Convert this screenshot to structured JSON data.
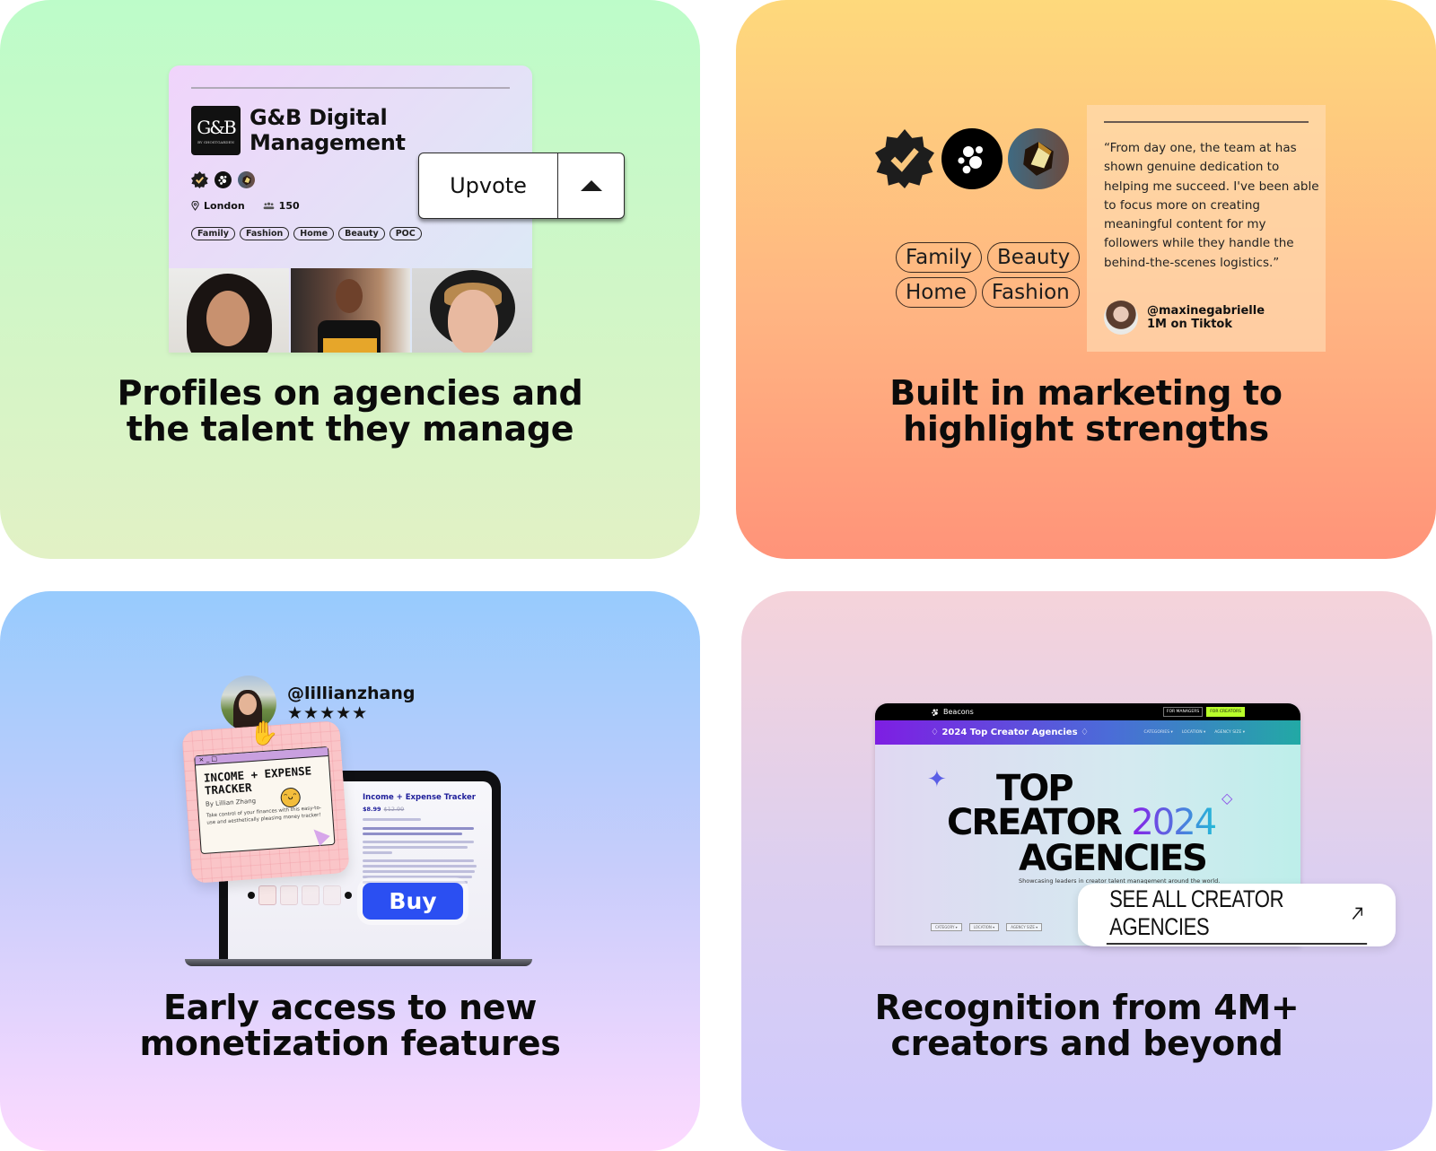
{
  "panels": {
    "profiles": {
      "caption": [
        "Profiles on agencies and",
        "the talent they manage"
      ],
      "agency": {
        "logo_text": "G&B",
        "logo_subtext": "BY GHOSTGARDEN",
        "name_line1": "G&B Digital",
        "name_line2": "Management",
        "badges": [
          "verified-badge-icon",
          "beacons-badge-icon",
          "gem-badge-icon"
        ],
        "location": "London",
        "talent_count": "150",
        "tags": [
          "Family",
          "Fashion",
          "Home",
          "Beauty",
          "POC"
        ]
      },
      "upvote_button": {
        "label": "Upvote",
        "arrow": "up-triangle-icon"
      }
    },
    "marketing": {
      "caption": [
        "Built in marketing to",
        "highlight strengths"
      ],
      "badges": [
        "verified-badge-icon",
        "beacons-badge-icon",
        "gem-badge-icon"
      ],
      "tags_row1": [
        "Family",
        "Beauty"
      ],
      "tags_row2": [
        "Home",
        "Fashion"
      ],
      "testimonial": {
        "quote": "“From day one, the team at has shown genuine dedication to helping me succeed. I've been able to focus more on creating meaningful content for my followers while they handle the behind-the-scenes logistics.”",
        "handle": "@maxinegabrielle",
        "followers": "1M on Tiktok"
      }
    },
    "monetization": {
      "caption": [
        "Early access to new",
        "monetization features"
      ],
      "creator": {
        "handle": "@lillianzhang",
        "rating": 5,
        "stars": "★★★★★"
      },
      "sticker": {
        "window_controls": "× _ □",
        "title_line1": "INCOME + EXPENSE",
        "title_line2": "TRACKER",
        "byline": "By Lillian Zhang",
        "description": "Take control of your finances with this easy-to-use and aesthetically pleasing money tracker!"
      },
      "product": {
        "title": "Income + Expense Tracker",
        "price": "$8.99",
        "original_price": "$12.99"
      },
      "buy_button": "Buy"
    },
    "recognition": {
      "caption": [
        "Recognition from 4M+",
        "creators and beyond"
      ],
      "site": {
        "brand": "Beacons",
        "nav_buttons": [
          "FOR MANAGERS",
          "FOR CREATORS"
        ],
        "subheader_title": "2024 Top Creator Agencies",
        "filters": [
          "CATEGORIES ▾",
          "LOCATION ▾",
          "AGENCY SIZE ▾"
        ],
        "hero_line1": "TOP",
        "hero_line2": "CREATOR",
        "hero_year": "2024",
        "hero_line3": "AGENCIES",
        "hero_subtitle": "Showcasing leaders in creator talent management around the world.",
        "selects": [
          "CATEGORY ▾",
          "LOCATION ▾",
          "AGENCY SIZE ▾"
        ]
      },
      "cta": {
        "label": "SEE ALL CREATOR AGENCIES",
        "icon": "arrow-up-right-icon"
      }
    }
  },
  "colors": {
    "panel1": [
      "#bdfcc9",
      "#e2f1c5"
    ],
    "panel2": [
      "#fed97c",
      "#ff9379"
    ],
    "panel3": [
      "#97cbfd",
      "#fddaff"
    ],
    "panel4": [
      "#f5d3da",
      "#cec9fd"
    ],
    "buy": "#2b4ff2",
    "creators_button": "#b9ff2b"
  }
}
